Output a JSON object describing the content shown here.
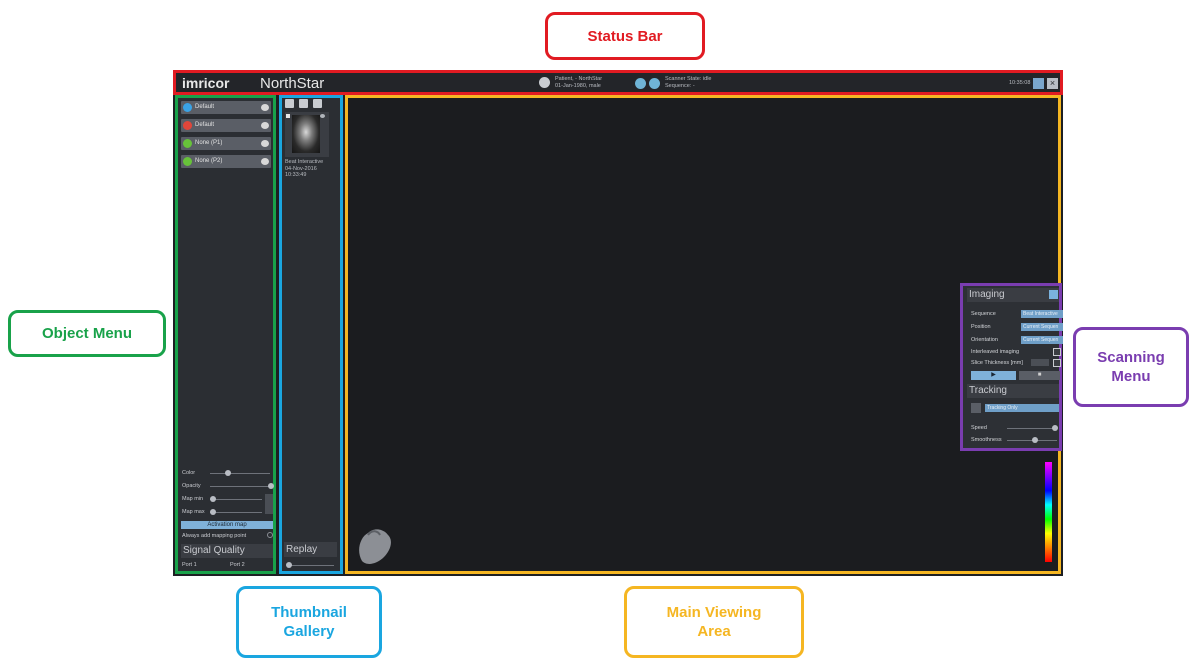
{
  "callouts": {
    "status_bar": "Status Bar",
    "object_menu": "Object Menu",
    "scanning_menu": "Scanning\nMenu",
    "thumbnail_gallery": "Thumbnail\nGallery",
    "main_viewing_area": "Main Viewing\nArea"
  },
  "colors": {
    "status_bar": "#e11b22",
    "object_menu": "#19a24a",
    "thumbnail_gallery": "#1aa6e0",
    "main_viewing_area": "#f5b622",
    "scanning_menu": "#7a3db0"
  },
  "header": {
    "logo": "imricor",
    "app_name": "NorthStar",
    "patient_name": "Patient, - NorthStar",
    "patient_info": "01-Jan-1980, male",
    "scanner_state": "Scanner State: idle",
    "sequence": "Sequence: -",
    "time": "10:35:08"
  },
  "object_menu": {
    "items": [
      {
        "label": "Default",
        "dot_color": "#3aa3e6",
        "icon": "dot-icon"
      },
      {
        "label": "Default",
        "dot_color": "#e0463a",
        "icon": "dot-icon"
      },
      {
        "label": "None (P1)",
        "dot_color": "#67c23a",
        "icon": "dot-icon"
      },
      {
        "label": "None (P2)",
        "dot_color": "#67c23a",
        "icon": "dot-icon"
      }
    ],
    "color_label": "Color",
    "opacity_label": "Opacity",
    "map_min_label": "Map min",
    "map_max_label": "Map max",
    "activation_map": "Activation map",
    "always_add": "Always add mapping point",
    "signal_quality": "Signal Quality",
    "port1": "Port 1",
    "port2": "Port 2"
  },
  "gallery": {
    "thumb_title": "Beat Interactive",
    "thumb_date": "04-Nov-2016 10:33:49",
    "replay_label": "Replay"
  },
  "scan_menu": {
    "imaging_title": "Imaging",
    "sequence_label": "Sequence",
    "sequence_value": "Beat Interactive",
    "position_label": "Position",
    "position_value": "Current Sequen",
    "orientation_label": "Orientation",
    "orientation_value": "Current Sequen",
    "interleaved_label": "Interleaved imaging",
    "slice_label": "Slice Thickness [mm]",
    "tracking_title": "Tracking",
    "tracking_value": "Tracking Only",
    "speed_label": "Speed",
    "smoothness_label": "Smoothness"
  }
}
